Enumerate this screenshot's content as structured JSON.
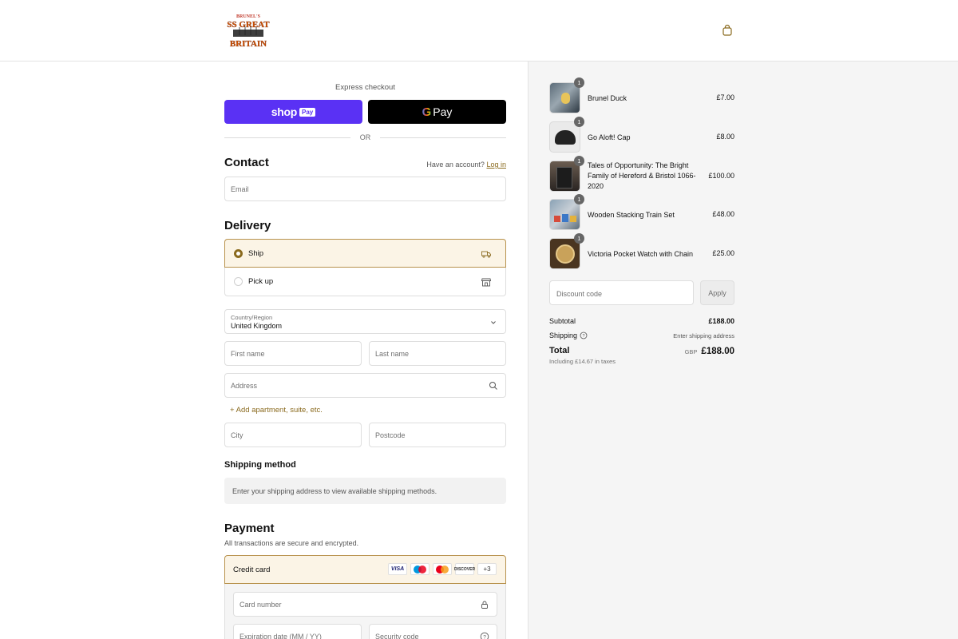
{
  "header": {
    "logo_top": "BRUNEL'S",
    "logo_main": "SS GREAT",
    "logo_bottom": "BRITAIN"
  },
  "express": {
    "label": "Express checkout",
    "shop_pay_brand": "shop",
    "shop_pay_badge": "Pay",
    "gpay_g": "G",
    "gpay_text": "Pay",
    "or": "OR"
  },
  "contact": {
    "title": "Contact",
    "account_prompt": "Have an account?",
    "login_link": "Log in",
    "email_placeholder": "Email"
  },
  "delivery": {
    "title": "Delivery",
    "options": [
      {
        "label": "Ship",
        "selected": true
      },
      {
        "label": "Pick up",
        "selected": false
      }
    ],
    "country_label": "Country/Region",
    "country_value": "United Kingdom",
    "first_name_placeholder": "First name",
    "last_name_placeholder": "Last name",
    "address_placeholder": "Address",
    "add_apartment": "+ Add apartment, suite, etc.",
    "city_placeholder": "City",
    "postcode_placeholder": "Postcode"
  },
  "shipping_method": {
    "title": "Shipping method",
    "note": "Enter your shipping address to view available shipping methods."
  },
  "payment": {
    "title": "Payment",
    "note": "All transactions are secure and encrypted.",
    "credit_card_label": "Credit card",
    "card_brands": [
      "VISA",
      "Maestro",
      "Mastercard",
      "DISCOVER"
    ],
    "more_cards": "+3",
    "card_number_placeholder": "Card number",
    "expiry_placeholder": "Expiration date (MM / YY)",
    "security_placeholder": "Security code"
  },
  "order": {
    "items": [
      {
        "name": "Brunel Duck",
        "qty": "1",
        "price": "£7.00"
      },
      {
        "name": "Go Aloft! Cap",
        "qty": "1",
        "price": "£8.00"
      },
      {
        "name": "Tales of Opportunity: The Bright Family of Hereford & Bristol 1066-2020",
        "qty": "1",
        "price": "£100.00"
      },
      {
        "name": "Wooden Stacking Train Set",
        "qty": "1",
        "price": "£48.00"
      },
      {
        "name": "Victoria Pocket Watch with Chain",
        "qty": "1",
        "price": "£25.00"
      }
    ],
    "discount_placeholder": "Discount code",
    "apply_label": "Apply",
    "subtotal_label": "Subtotal",
    "subtotal_value": "£188.00",
    "shipping_label": "Shipping",
    "shipping_value": "Enter shipping address",
    "total_label": "Total",
    "taxes_note": "Including £14.67 in taxes",
    "currency": "GBP",
    "total_value": "£188.00"
  },
  "colors": {
    "shop_pay": "#5a31f4",
    "accent": "#8a6a1e",
    "selected_bg": "#fbf4e6",
    "logo_red": "#c0392b"
  }
}
